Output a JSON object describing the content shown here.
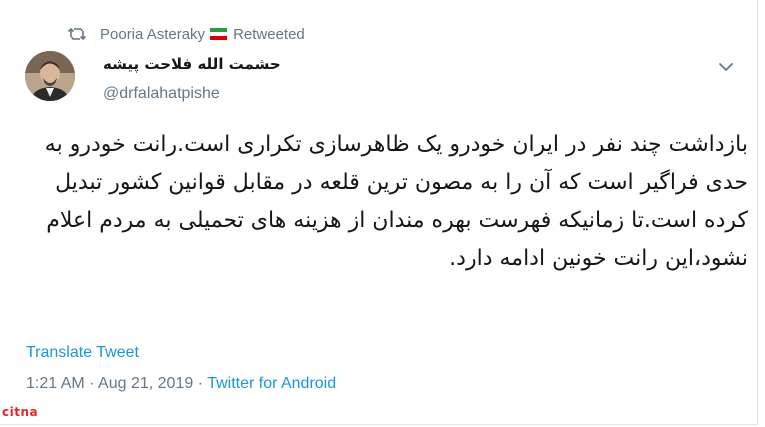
{
  "retweet": {
    "user": "Pooria Asteraky",
    "label": "Retweeted",
    "flag_colors": [
      "#239f40",
      "#ffffff",
      "#da0000"
    ]
  },
  "author": {
    "name": "حشمت الله فلاحت پیشه",
    "handle": "@drfalahatpishe"
  },
  "tweet": {
    "text": "بازداشت چند نفر در ایران خودرو یک ظاهرسازی تکراری است.رانت خودرو به حدی فراگیر است که آن را به مصون ترین قلعه در مقابل قوانین کشور تبدیل کرده است.تا زمانیکه فهرست بهره مندان از هزینه های تحمیلی به مردم اعلام نشود،این رانت خونین ادامه دارد."
  },
  "actions": {
    "translate_label": "Translate Tweet"
  },
  "meta": {
    "time": "1:21 AM",
    "separator": " · ",
    "date": "Aug 21, 2019",
    "source": "Twitter for Android"
  },
  "watermark": {
    "text": "citna"
  },
  "colors": {
    "link": "#1b95e0",
    "muted": "#657786",
    "text": "#14171a",
    "watermark": "#e3262e"
  },
  "icons": {
    "retweet": "retweet-icon",
    "caret": "chevron-down-icon"
  }
}
